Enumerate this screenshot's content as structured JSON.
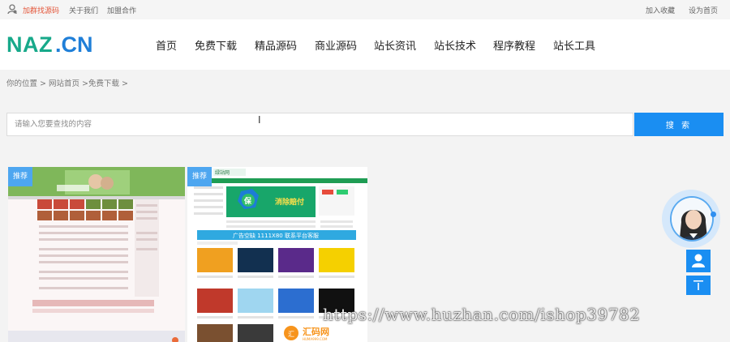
{
  "topbar": {
    "left_links": [
      "加群找源码",
      "关于我们",
      "加盟合作"
    ],
    "right_links": [
      "加入收藏",
      "设为首页"
    ]
  },
  "logo": {
    "text": "NAZ.CN"
  },
  "nav": [
    "首页",
    "免费下载",
    "精品源码",
    "商业源码",
    "站长资讯",
    "站长技术",
    "程序教程",
    "站长工具"
  ],
  "breadcrumb": "你的位置 > 网站首页 >免费下载 >",
  "search": {
    "placeholder": "请输入您要查找的内容",
    "button_label": "搜 索"
  },
  "cards": [
    {
      "badge": "推荐"
    },
    {
      "badge": "推荐",
      "thumb_logo": "绿站网",
      "banner_text": "广告空缺  1111X80  联系平台客服",
      "bottom_logo": "汇码网",
      "bottom_logo_sub": "HUMA999.COM",
      "hero_text": "消除赔付"
    }
  ],
  "watermark": "https://www.huzhan.com/ishop39782",
  "colors": {
    "accent": "#1a8ef2",
    "logo_teal": "#17a98a",
    "logo_blue": "#1f7fd8",
    "badge": "#4da6f0",
    "red_link": "#e4573b"
  }
}
